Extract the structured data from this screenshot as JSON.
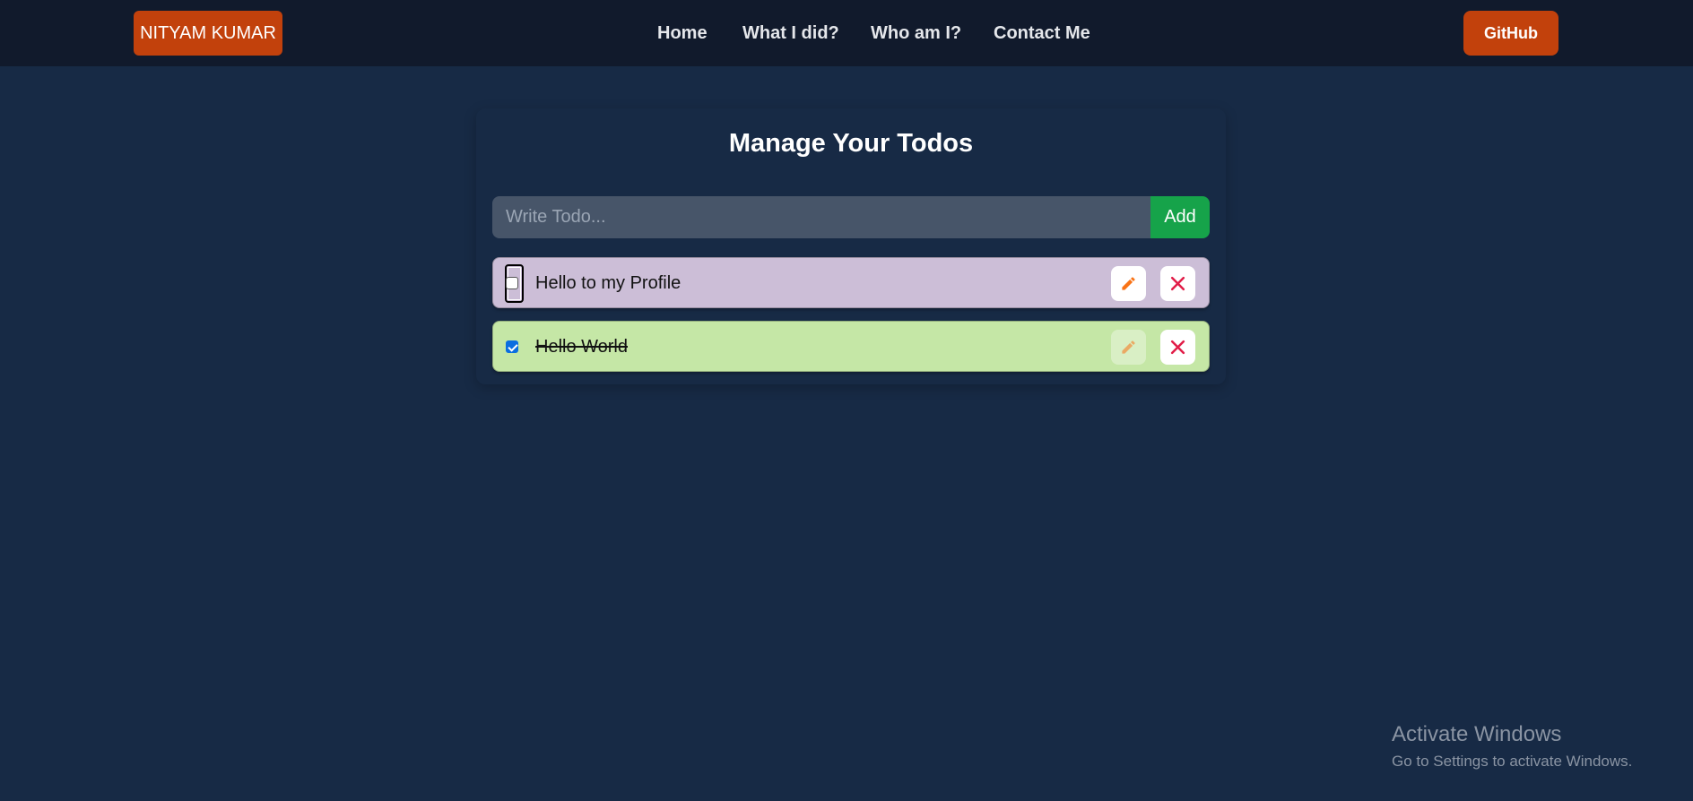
{
  "navbar": {
    "brand": "NITYAM KUMAR",
    "links": [
      "Home",
      "What I did?",
      "Who am I?",
      "Contact Me"
    ],
    "github_label": "GitHub"
  },
  "main": {
    "title": "Manage Your Todos",
    "input": {
      "placeholder": "Write Todo...",
      "value": ""
    },
    "add_label": "Add",
    "todos": [
      {
        "text": "Hello to my Profile",
        "completed": false,
        "color": "#ccbed7"
      },
      {
        "text": "Hello World",
        "completed": true,
        "color": "#c5e7a6"
      }
    ]
  },
  "watermark": {
    "title": "Activate Windows",
    "subtitle": "Go to Settings to activate Windows."
  },
  "colors": {
    "background": "#172a45",
    "navbar": "#111a2c",
    "accent_orange": "#c2410c",
    "add_green": "#16a34a",
    "edit_icon": "#f97316",
    "delete_icon": "#e11d48"
  },
  "icons": {
    "edit": "pencil-icon",
    "delete": "close-icon"
  }
}
